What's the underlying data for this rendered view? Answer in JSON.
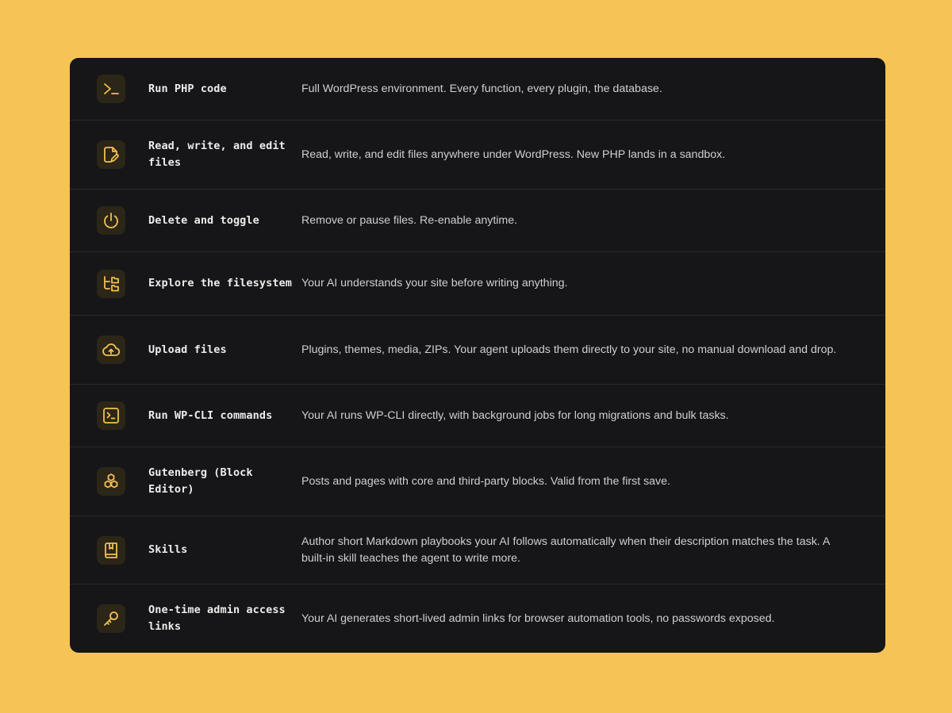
{
  "features": [
    {
      "icon": "terminal-prompt-icon",
      "title": "Run PHP code",
      "description": "Full WordPress environment. Every function, every plugin, the database."
    },
    {
      "icon": "file-edit-icon",
      "title": "Read, write, and edit files",
      "description": "Read, write, and edit files anywhere under WordPress. New PHP lands in a sandbox."
    },
    {
      "icon": "power-icon",
      "title": "Delete and toggle",
      "description": "Remove or pause files. Re-enable anytime."
    },
    {
      "icon": "folder-tree-icon",
      "title": "Explore the filesystem",
      "description": "Your AI understands your site before writing anything."
    },
    {
      "icon": "cloud-upload-icon",
      "title": "Upload files",
      "description": "Plugins, themes, media, ZIPs. Your agent uploads them directly to your site, no manual download and drop."
    },
    {
      "icon": "terminal-square-icon",
      "title": "Run WP-CLI commands",
      "description": "Your AI runs WP-CLI directly, with background jobs for long migrations and bulk tasks."
    },
    {
      "icon": "blocks-icon",
      "title": "Gutenberg (Block Editor)",
      "description": "Posts and pages with core and third-party blocks. Valid from the first save."
    },
    {
      "icon": "book-bookmark-icon",
      "title": "Skills",
      "description": "Author short Markdown playbooks your AI follows automatically when their description matches the task. A built-in skill teaches the agent to write more."
    },
    {
      "icon": "key-icon",
      "title": "One-time admin access links",
      "description": "Your AI generates short-lived admin links for browser automation tools, no passwords exposed."
    }
  ],
  "colors": {
    "page_background": "#f5c356",
    "card_background": "#161618",
    "icon_accent": "#f2bf55"
  }
}
